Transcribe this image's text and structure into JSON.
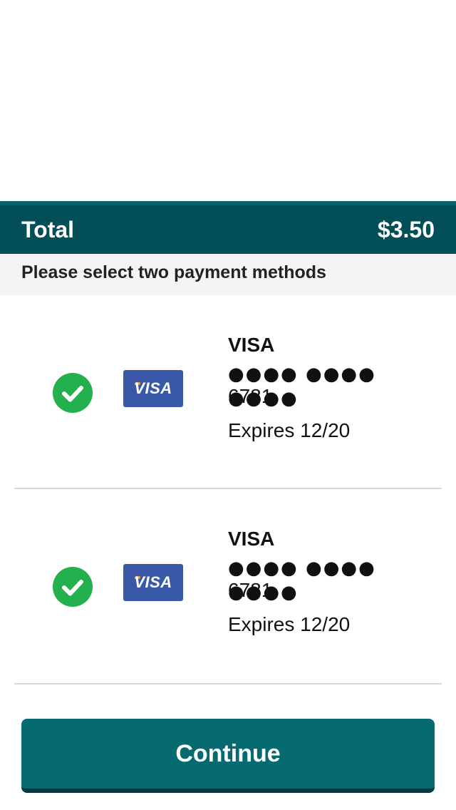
{
  "total": {
    "label": "Total",
    "amount": "$3.50"
  },
  "instructions": "Please select two payment methods",
  "payment_methods": [
    {
      "selected": true,
      "logo_text": "VISA",
      "brand": "VISA",
      "masked_number": "●●●● ●●●● ●●●●",
      "last4": "6781",
      "expiry": "Expires 12/20"
    },
    {
      "selected": true,
      "logo_text": "VISA",
      "brand": "VISA",
      "masked_number": "●●●● ●●●● ●●●●",
      "last4": "6781",
      "expiry": "Expires 12/20"
    }
  ],
  "continue_label": "Continue",
  "icons": {
    "check": "check-circle-icon",
    "card": "visa-logo-icon"
  },
  "colors": {
    "header_bg": "#034f57",
    "button_bg": "#066b70",
    "check_green": "#22b14c",
    "visa_blue": "#3a58a8"
  }
}
